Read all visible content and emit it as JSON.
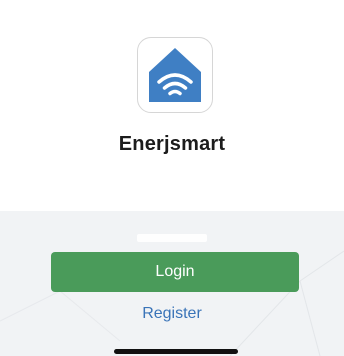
{
  "app": {
    "name": "Enerjsmart",
    "icon": "house-wifi-icon",
    "icon_color": "#3f7fc4"
  },
  "actions": {
    "login_label": "Login",
    "register_label": "Register"
  },
  "colors": {
    "login_button": "#4a9b5a",
    "register_link": "#3a74b8",
    "lower_background": "#f1f3f5"
  }
}
